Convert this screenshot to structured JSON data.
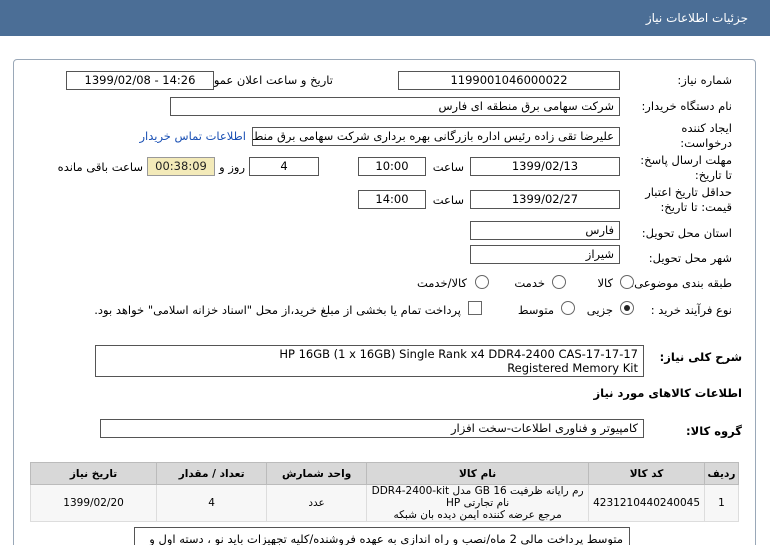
{
  "header": {
    "title": "جزئیات اطلاعات نیاز"
  },
  "form": {
    "need_number_label": "شماره نیاز:",
    "need_number": "1199001046000022",
    "announce_label": "تاریخ و ساعت اعلان عمومی:",
    "announce_value": "1399/02/08 - 14:26",
    "buyer_label": "نام دستگاه خریدار:",
    "buyer_value": "شرکت سهامی برق منطقه ای فارس",
    "creator_label_1": "ایجاد کننده",
    "creator_label_2": "درخواست:",
    "creator_value": "علیرضا  تقی زاده رئیس اداره بازرگانی بهره برداری شرکت سهامی برق منطقه ای",
    "contact_link": "اطلاعات تماس خریدار",
    "deadline_label_1": "مهلت ارسال پاسخ:",
    "deadline_label_2": "تا تاریخ:",
    "deadline_date": "1399/02/13",
    "time_label": "ساعت",
    "deadline_time": "10:00",
    "days_value": "4",
    "days_label": "روز و",
    "timer_value": "00:38:09",
    "remaining_label": "ساعت باقی مانده",
    "validity_label_1": "حداقل تاریخ اعتبار",
    "validity_label_2": "قیمت: تا تاریخ:",
    "validity_date": "1399/02/27",
    "validity_time": "14:00",
    "province_label": "استان محل تحویل:",
    "province_value": "فارس",
    "city_label": "شهر محل تحویل:",
    "city_value": "شیراز",
    "category_label": "طبقه بندی موضوعی:",
    "cat_goods": "کالا",
    "cat_service": "خدمت",
    "cat_goods_service": "کالا/خدمت",
    "process_label": "نوع فرآیند خرید :",
    "proc_small": "جزیی",
    "proc_medium": "متوسط",
    "payment_note": "پرداخت تمام یا بخشی از مبلغ خرید،از محل \"اسناد خزانه اسلامی\" خواهد بود.",
    "summary_label": "شرح کلی نیاز:",
    "summary_line1": "HP 16GB (1 x 16GB) Single Rank x4 DDR4-2400 CAS-17-17-17",
    "summary_line2": "Registered Memory Kit",
    "goods_info_label": "اطلاعات کالاهای مورد نیاز",
    "group_label": "گروه کالا:",
    "group_value": "کامپیوتر و فناوری اطلاعات-سخت افزار"
  },
  "table": {
    "headers": [
      "ردیف",
      "کد کالا",
      "نام کالا",
      "واحد شمارش",
      "تعداد / مقدار",
      "تاریخ نیاز"
    ],
    "row": {
      "index": "1",
      "code": "4231210440240045",
      "name_line1": "رم رایانه ظرفیت 16 GB مدل DDR4-2400-kit نام تجارتی HP",
      "name_line2": "مرجع عرضه کننده ایمن دیده بان شبکه",
      "unit": "عدد",
      "qty": "4",
      "date": "1399/02/20"
    }
  },
  "note_text": "متوسط پرداخت مالی 2 ماه/نصب و راه اندازی به عهده فروشنده/کلیه تجهیزات باید نو ، دسته اول و"
}
